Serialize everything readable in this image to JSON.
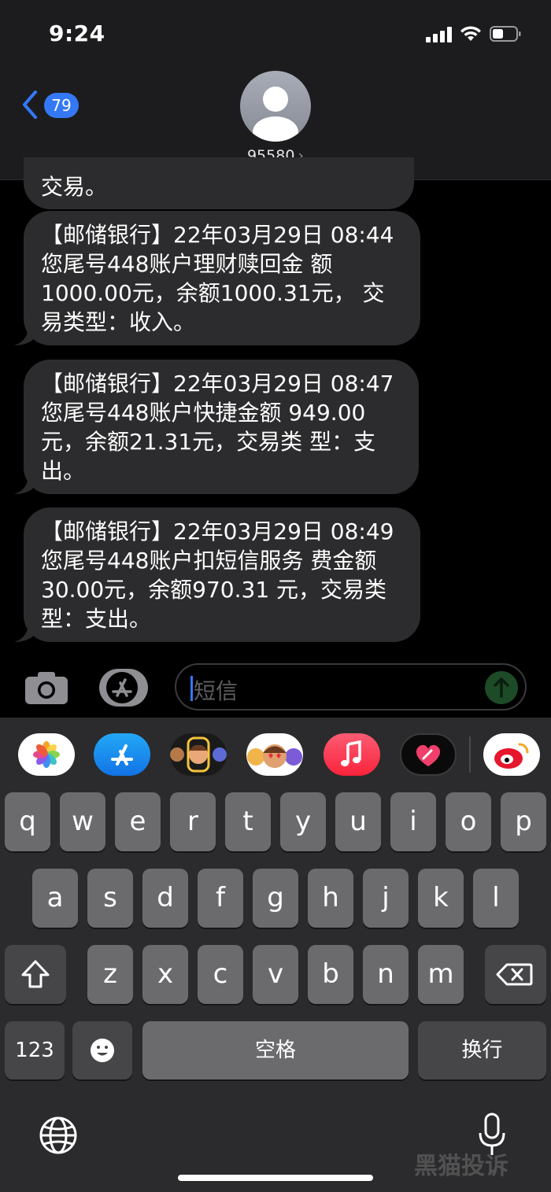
{
  "status_bar": {
    "time": "9:24"
  },
  "header": {
    "back_badge": "79",
    "contact_name": "95580",
    "contact_chevron": "›"
  },
  "messages": {
    "partial_top": "交易。",
    "items": [
      {
        "lines": [
          "【邮储银行】22年03月29日",
          "08:44您尾号448账户理财赎回金",
          "额1000.00元，余额1000.31元，",
          "交易类型：收入。"
        ]
      },
      {
        "lines": [
          "【邮储银行】22年03月29日",
          "08:47您尾号448账户快捷金额",
          "949.00元，余额21.31元，交易类",
          "型：支出。"
        ]
      },
      {
        "lines": [
          "【邮储银行】22年03月29日",
          "08:49您尾号448账户扣短信服务",
          "费金额30.00元，余额970.31",
          "元，交易类型：支出。"
        ]
      }
    ]
  },
  "compose": {
    "placeholder": "短信"
  },
  "keyboard": {
    "row1": [
      "q",
      "w",
      "e",
      "r",
      "t",
      "y",
      "u",
      "i",
      "o",
      "p"
    ],
    "row2": [
      "a",
      "s",
      "d",
      "f",
      "g",
      "h",
      "j",
      "k",
      "l"
    ],
    "row3": [
      "z",
      "x",
      "c",
      "v",
      "b",
      "n",
      "m"
    ],
    "numbers_key": "123",
    "space_key": "空格",
    "return_key": "换行"
  },
  "app_strip": [
    "photos-app-icon",
    "app-store-app-icon",
    "memoji-app-icon",
    "animoji-app-icon",
    "music-app-icon",
    "digital-touch-app-icon",
    "weibo-app-icon"
  ],
  "watermark": "黑猫投诉",
  "colors": {
    "accent": "#3478f6",
    "bubble": "#2c2c2e",
    "header_bg": "#1c1c1e",
    "keyboard_bg": "#2b2b2d",
    "key": "#6b6b6e"
  }
}
